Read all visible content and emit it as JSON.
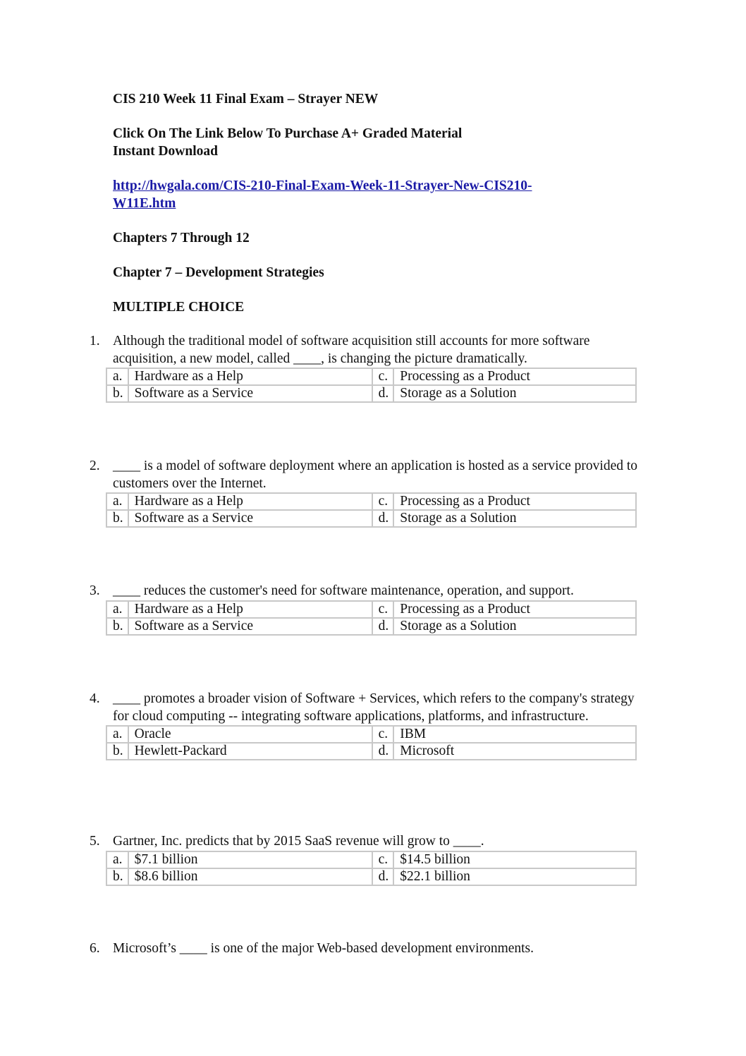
{
  "header": {
    "title": "CIS 210 Week 11 Final Exam – Strayer NEW",
    "promo_line1": "Click On The Link Below To Purchase A+ Graded Material",
    "promo_line2": "Instant Download",
    "link_line1": "http://hwgala.com/CIS-210-Final-Exam-Week-11-Strayer-New-CIS210-",
    "link_line2": "W11E.htm",
    "chapters": "Chapters 7 Through 12",
    "chapter_heading": "Chapter 7 – Development Strategies",
    "section": "MULTIPLE CHOICE"
  },
  "questions": [
    {
      "number": "1.",
      "text": "Although the traditional model of software acquisition still accounts for more software acquisition, a new model, called ____, is changing the picture dramatically.",
      "options": [
        {
          "letter": "a.",
          "text": "Hardware as a Help"
        },
        {
          "letter": "b.",
          "text": "Software as a Service"
        },
        {
          "letter": "c.",
          "text": "Processing as a Product"
        },
        {
          "letter": "d.",
          "text": "Storage as a Solution"
        }
      ]
    },
    {
      "number": "2.",
      "text": "____ is a model of software deployment where an application is hosted as a service provided to customers over the Internet.",
      "options": [
        {
          "letter": "a.",
          "text": "Hardware as a Help"
        },
        {
          "letter": "b.",
          "text": "Software as a Service"
        },
        {
          "letter": "c.",
          "text": "Processing as a Product"
        },
        {
          "letter": "d.",
          "text": "Storage as a Solution"
        }
      ]
    },
    {
      "number": "3.",
      "text": "____ reduces the customer's need for software maintenance, operation, and support.",
      "options": [
        {
          "letter": "a.",
          "text": "Hardware as a Help"
        },
        {
          "letter": "b.",
          "text": "Software as a Service"
        },
        {
          "letter": "c.",
          "text": "Processing as a Product"
        },
        {
          "letter": "d.",
          "text": "Storage as a Solution"
        }
      ]
    },
    {
      "number": "4.",
      "text": "____ promotes a broader vision of Software + Services, which refers to the company's strategy for cloud computing -- integrating software applications, platforms, and infrastructure.",
      "options": [
        {
          "letter": "a.",
          "text": "Oracle"
        },
        {
          "letter": "b.",
          "text": "Hewlett-Packard"
        },
        {
          "letter": "c.",
          "text": "IBM"
        },
        {
          "letter": "d.",
          "text": "Microsoft"
        }
      ]
    },
    {
      "number": "5.",
      "text": "Gartner, Inc. predicts that by 2015 SaaS revenue will grow to ____.",
      "options": [
        {
          "letter": "a.",
          "text": "$7.1 billion"
        },
        {
          "letter": "b.",
          "text": "$8.6 billion"
        },
        {
          "letter": "c.",
          "text": "$14.5 billion"
        },
        {
          "letter": "d.",
          "text": "$22.1 billion"
        }
      ]
    },
    {
      "number": "6.",
      "text": "Microsoft’s ____ is one of the major Web-based development environments."
    }
  ]
}
